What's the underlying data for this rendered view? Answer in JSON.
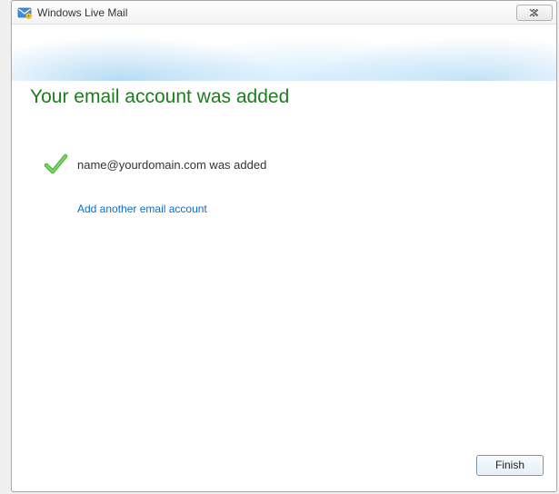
{
  "window": {
    "title": "Windows Live Mail"
  },
  "main": {
    "heading": "Your email account was added",
    "status_message": "name@yourdomain.com was added",
    "add_another_label": "Add another email account"
  },
  "footer": {
    "finish_label": "Finish"
  },
  "icons": {
    "app": "mail-app-icon",
    "close": "close-icon",
    "check": "checkmark-icon"
  },
  "colors": {
    "heading_green": "#1e7b1e",
    "link_blue": "#0a6cce",
    "check_green": "#4fb23a"
  }
}
